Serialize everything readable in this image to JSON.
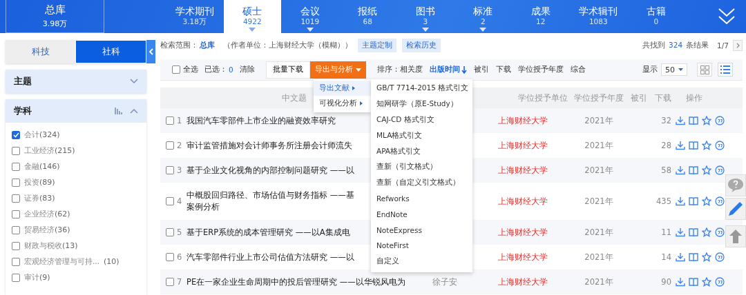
{
  "top_nav": {
    "home": {
      "label": "总库",
      "count": "3.98万"
    },
    "tabs": [
      {
        "label": "学术期刊",
        "count": "3.18万",
        "selected": false,
        "has_menu": false
      },
      {
        "label": "硕士",
        "count": "4922",
        "selected": true,
        "has_menu": true
      },
      {
        "label": "会议",
        "count": "1019",
        "selected": false,
        "has_menu": true
      },
      {
        "label": "报纸",
        "count": "68",
        "selected": false,
        "has_menu": false
      },
      {
        "label": "图书",
        "count": "3",
        "selected": false,
        "has_menu": true
      },
      {
        "label": "标准",
        "count": "2",
        "selected": false,
        "has_menu": true
      },
      {
        "label": "成果",
        "count": "12",
        "selected": false,
        "has_menu": false
      },
      {
        "label": "学术辑刊",
        "count": "1083",
        "selected": false,
        "has_menu": false
      },
      {
        "label": "古籍",
        "count": "0",
        "selected": false,
        "has_menu": false
      }
    ]
  },
  "sidebar": {
    "segments": [
      {
        "label": "科技",
        "selected": false
      },
      {
        "label": "社科",
        "selected": true
      }
    ],
    "panels": [
      {
        "title": "主题",
        "expanded": false
      },
      {
        "title": "学科",
        "expanded": true,
        "items": [
          {
            "label": "会计",
            "count": "(324)",
            "checked": true
          },
          {
            "label": "工业经济",
            "count": "(215)",
            "checked": false
          },
          {
            "label": "金融",
            "count": "(146)",
            "checked": false
          },
          {
            "label": "投资",
            "count": "(89)",
            "checked": false
          },
          {
            "label": "证券",
            "count": "(83)",
            "checked": false
          },
          {
            "label": "企业经济",
            "count": "(62)",
            "checked": false
          },
          {
            "label": "贸易经济",
            "count": "(36)",
            "checked": false
          },
          {
            "label": "财政与税收",
            "count": "(13)",
            "checked": false
          },
          {
            "label": "宏观经济管理与可持...",
            "count": "(10)",
            "checked": false
          },
          {
            "label": "审计",
            "count": "(9)",
            "checked": false
          }
        ]
      }
    ]
  },
  "scope": {
    "label": "检索范围：",
    "value": "总库",
    "condition": "（作者单位：上海财经大学（模糊））",
    "buttons": [
      "主题定制",
      "检索历史"
    ],
    "total_prefix": "共找到",
    "total": "324",
    "total_suffix": "条结果",
    "page": "1/7"
  },
  "toolbar": {
    "select_all": {
      "label": "全选",
      "checked": false
    },
    "selected_label": "已选：",
    "selected_count": "0",
    "clear": "清除",
    "batch": "批量下载",
    "export": "导出与分析",
    "sort_label": "排序：",
    "sorts": [
      {
        "label": "相关度",
        "selected": false
      },
      {
        "label": "出版时间",
        "selected": true
      },
      {
        "label": "被引",
        "selected": false
      },
      {
        "label": "下载",
        "selected": false
      },
      {
        "label": "学位授予年度",
        "selected": false
      },
      {
        "label": "综合",
        "selected": false
      }
    ],
    "display_label": "显示",
    "page_size": "50",
    "views": [
      {
        "kind": "grid",
        "selected": false
      },
      {
        "kind": "list",
        "selected": true
      }
    ]
  },
  "table": {
    "columns": [
      {
        "kind": "title",
        "label": "中文题"
      },
      {
        "kind": "unit",
        "label": "学位授予单位"
      },
      {
        "kind": "year",
        "label": "学位授予年度"
      },
      {
        "kind": "cited",
        "label": "被引"
      },
      {
        "kind": "downloads",
        "label": "下载"
      },
      {
        "kind": "ops",
        "label": "操作"
      }
    ],
    "rows": [
      {
        "number": "1",
        "checked": false,
        "title_lines": [
          "我国汽车零部件上市企业的融资效率研究"
        ],
        "unit": "上海财经大学",
        "year": "2021年",
        "downloads": "32"
      },
      {
        "number": "2",
        "checked": false,
        "title_lines": [
          "审计监管措施对会计师事务所注册会计师流失"
        ],
        "unit": "上海财经大学",
        "year": "2021年",
        "downloads": "28"
      },
      {
        "number": "3",
        "checked": false,
        "title_lines": [
          "基于企业文化视角的内部控制问题研究 ——以"
        ],
        "unit": "上海财经大学",
        "year": "2021年",
        "downloads": "58"
      },
      {
        "number": "4",
        "checked": false,
        "title_lines": [
          "中概股回归路径、市场估值与财务指标 ——基",
          "案例分析"
        ],
        "unit": "上海财经大学",
        "year": "2021年",
        "downloads": "435"
      },
      {
        "number": "5",
        "checked": false,
        "title_lines": [
          "基于ERP系统的成本管理研究 ——以A集成电"
        ],
        "unit": "上海财经大学",
        "year": "2021年",
        "downloads": "11"
      },
      {
        "number": "6",
        "checked": false,
        "title_lines": [
          "汽车零部件行业上市公司估值方法研究 ——以"
        ],
        "unit": "上海财经大学",
        "year": "2021年",
        "downloads": "14"
      },
      {
        "number": "7",
        "checked": false,
        "title_lines": [
          "PE在一家企业生命周期中的投后管理研究 ——以华锐风电为"
        ],
        "author": "徐子安",
        "unit": "上海财经大学",
        "year": "2021年",
        "downloads": "90"
      }
    ]
  },
  "export_menu": {
    "items": [
      {
        "label": "导出文献",
        "selected": true
      },
      {
        "label": "可视化分析",
        "selected": false
      }
    ],
    "submenu": [
      "GB/T 7714-2015 格式引文",
      "知网研学（原E-Study）",
      "CAJ-CD 格式引文",
      "MLA格式引文",
      "APA格式引文",
      "查新（引文格式）",
      "查新（自定义引文格式）",
      "Refworks",
      "EndNote",
      "NoteExpress",
      "NoteFirst",
      "自定义"
    ]
  }
}
